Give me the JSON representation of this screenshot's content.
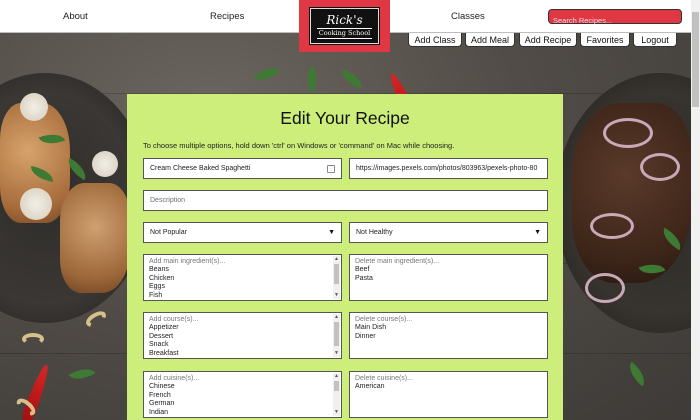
{
  "nav": {
    "about": "About",
    "recipes": "Recipes",
    "classes": "Classes",
    "logo_title": "Rick's",
    "logo_subtitle": "Cooking School",
    "search_placeholder": "Search Recipes..."
  },
  "actions": {
    "add_class": "Add Class",
    "add_meal": "Add Meal",
    "add_recipe": "Add Recipe",
    "favorites": "Favorites",
    "logout": "Logout"
  },
  "form": {
    "title": "Edit Your Recipe",
    "hint": "To choose multiple options, hold down 'ctrl' on Windows or 'command' on Mac while choosing.",
    "recipe_name": "Cream Cheese Baked Spaghetti",
    "image_url": "https://images.pexels.com/photos/803963/pexels-photo-80",
    "description_placeholder": "Description",
    "popularity": "Not Popular",
    "health": "Not Healthy",
    "add_ingredients": {
      "placeholder": "Add main ingredient(s)...",
      "options": [
        "Beans",
        "Chicken",
        "Eggs",
        "Fish"
      ]
    },
    "delete_ingredients": {
      "placeholder": "Delete main ingredient(s)...",
      "options": [
        "Beef",
        "Pasta"
      ]
    },
    "add_courses": {
      "placeholder": "Add course(s)...",
      "options": [
        "Appetizer",
        "Dessert",
        "Snack",
        "Breakfast"
      ]
    },
    "delete_courses": {
      "placeholder": "Delete course(s)...",
      "options": [
        "Main Dish",
        "Dinner"
      ]
    },
    "add_cuisines": {
      "placeholder": "Add cuisine(s)...",
      "options": [
        "Chinese",
        "French",
        "German",
        "Indian"
      ]
    },
    "delete_cuisines": {
      "placeholder": "Delete cuisine(s)...",
      "options": [
        "American"
      ]
    }
  },
  "colors": {
    "accent": "#e03745",
    "panel": "#cdee7a"
  }
}
